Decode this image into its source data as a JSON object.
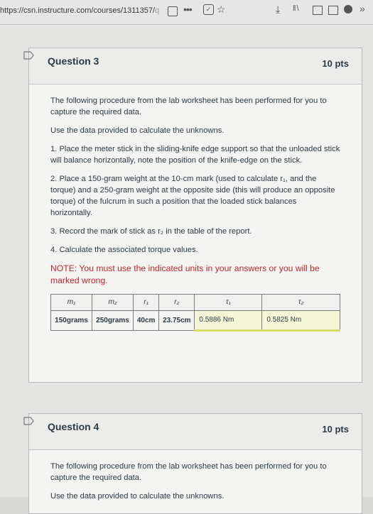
{
  "browser": {
    "url_main": "https://csn.instructure.com/courses/1311357/",
    "url_faint": "q"
  },
  "question3": {
    "title": "Question 3",
    "points": "10 pts",
    "paragraphs": [
      "The following procedure from the lab worksheet has been performed for you to capture the required data.",
      "Use the data provided to calculate the unknowns.",
      "1. Place the meter stick in the sliding-knife edge support so that the unloaded stick will balance horizontally, note the position of the knife-edge on the stick.",
      "2. Place a 150-gram weight at the 10-cm mark (used to calculate r₁, and the torque) and a 250-gram weight at the opposite side (this will produce an opposite torque) of the fulcrum in such a position that the loaded stick balances horizontally.",
      "3. Record the mark of stick as r₂ in the table of the report.",
      "4. Calculate the associated torque values."
    ],
    "note": "NOTE: You must use the indicated units in your answers or you will be marked wrong.",
    "table": {
      "headers": [
        "m₁",
        "m₂",
        "r₁",
        "r₂",
        "τ₁",
        "τ₂"
      ],
      "values": [
        "150grams",
        "250grams",
        "40cm",
        "23.75cm"
      ],
      "answer1": "0.5886 Nm",
      "answer2": "0.5825 Nm"
    }
  },
  "question4": {
    "title": "Question 4",
    "points": "10 pts",
    "paragraph": "The following procedure from the lab worksheet has been performed for you to capture the required data.",
    "cutoff": "Use the data provided to calculate the unknowns."
  }
}
